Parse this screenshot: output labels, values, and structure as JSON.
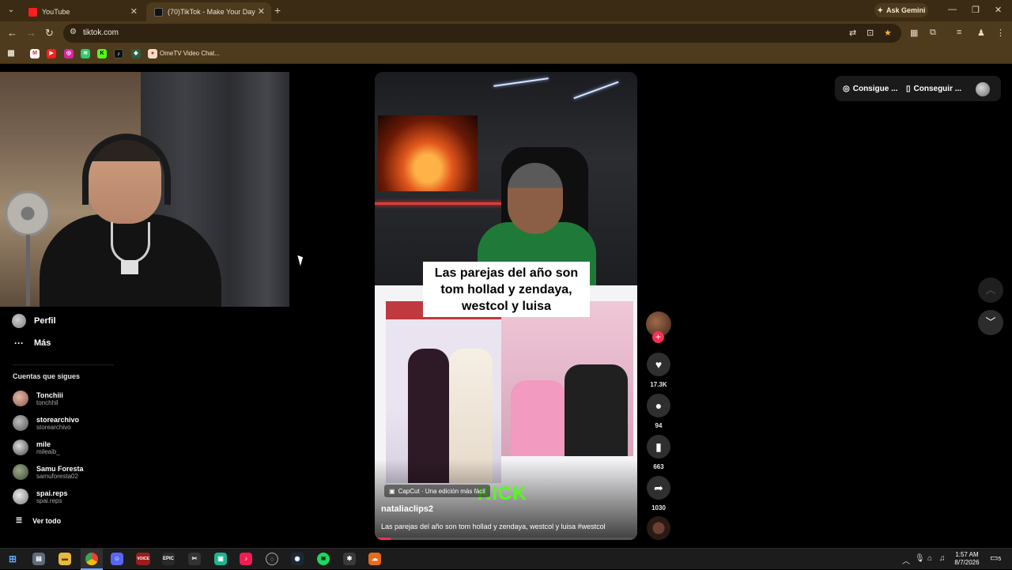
{
  "browser": {
    "tabs": [
      {
        "title": "YouTube",
        "favicon": "youtube-icon",
        "active": false
      },
      {
        "title": "(70)TikTok - Make Your Day",
        "favicon": "tiktok-icon",
        "active": true
      }
    ],
    "ask_gemini": "Ask Gemini",
    "url": "tiktok.com",
    "bookmark_label": "OmeTV Video Chat..."
  },
  "sidebar": {
    "profile_label": "Perfil",
    "more_label": "Más",
    "following_title": "Cuentas que sigues",
    "following": [
      {
        "name": "Tonchiii",
        "handle": "tonchhil"
      },
      {
        "name": "storearchivo",
        "handle": "storearchivo"
      },
      {
        "name": "mile",
        "handle": "mileaib_"
      },
      {
        "name": "Samu Foresta",
        "handle": "samuforesta02"
      },
      {
        "name": "spai.reps",
        "handle": "spai.reps"
      }
    ],
    "see_all": "Ver todo"
  },
  "video": {
    "overlay_text_line1": "Las parejas del año son",
    "overlay_text_line2": "tom hollad y zendaya,",
    "overlay_text_line3": "westcol y luisa",
    "kick_logo": "KICK",
    "capcut_label": "CapCut · Una edición más fácil",
    "author": "nataliaclips2",
    "description": "Las parejas del año son tom hollad y zendaya, westcol y luisa #westcol",
    "progress": 0.06
  },
  "actions": {
    "likes": "17.3K",
    "comments": "94",
    "saves": "663",
    "shares": "1030"
  },
  "top_right": {
    "coins_label": "Consigue ...",
    "app_label": "Conseguir ..."
  },
  "taskbar": {
    "time": "1:57 AM",
    "date": "8/7/2026",
    "notifications": "5"
  },
  "colors": {
    "accent": "#fe2c55",
    "kick_green": "#53fc18",
    "chrome_bg": "#4e3a1c"
  }
}
